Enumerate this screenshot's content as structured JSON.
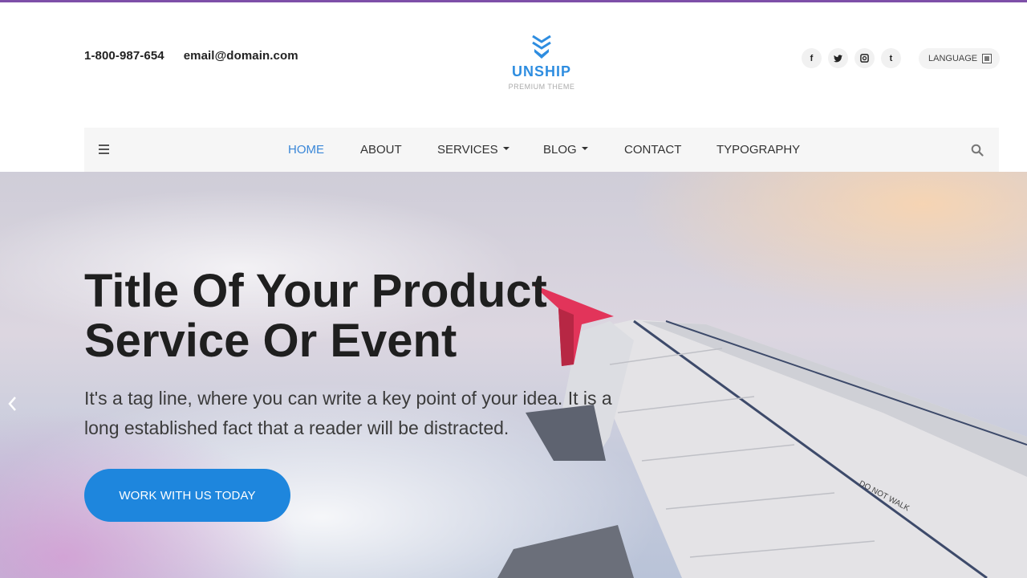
{
  "colors": {
    "accent": "#1e86dd",
    "nav_active": "#3a87d8",
    "top_strip": "#7e4fa8",
    "logo": "#2e8de0"
  },
  "header": {
    "phone": "1-800-987-654",
    "email": "email@domain.com",
    "logo": {
      "icon": "chevron-shield-icon",
      "name": "UNSHIP",
      "tagline": "PREMIUM THEME"
    },
    "socials": [
      {
        "icon": "facebook-icon",
        "glyph": "f"
      },
      {
        "icon": "twitter-icon",
        "glyph": "🐦"
      },
      {
        "icon": "instagram-icon",
        "glyph": "◙"
      },
      {
        "icon": "tumblr-icon",
        "glyph": "t"
      }
    ],
    "language": {
      "label": "LANGUAGE",
      "icon": "language-flag-icon"
    }
  },
  "nav": {
    "menu_icon": "hamburger-icon",
    "items": [
      {
        "label": "HOME",
        "active": true
      },
      {
        "label": "ABOUT"
      },
      {
        "label": "SERVICES",
        "dropdown": true
      },
      {
        "label": "BLOG",
        "dropdown": true
      },
      {
        "label": "CONTACT"
      },
      {
        "label": "TYPOGRAPHY"
      }
    ],
    "search_icon": "search-icon"
  },
  "hero": {
    "title_line1": "Title Of Your Product",
    "title_line2": "Service Or Event",
    "tagline": "It's a tag line, where you can write a key point of your idea. It is a long established fact that a reader will be distracted.",
    "cta": "WORK WITH US TODAY",
    "prev_icon": "chevron-left-icon"
  }
}
